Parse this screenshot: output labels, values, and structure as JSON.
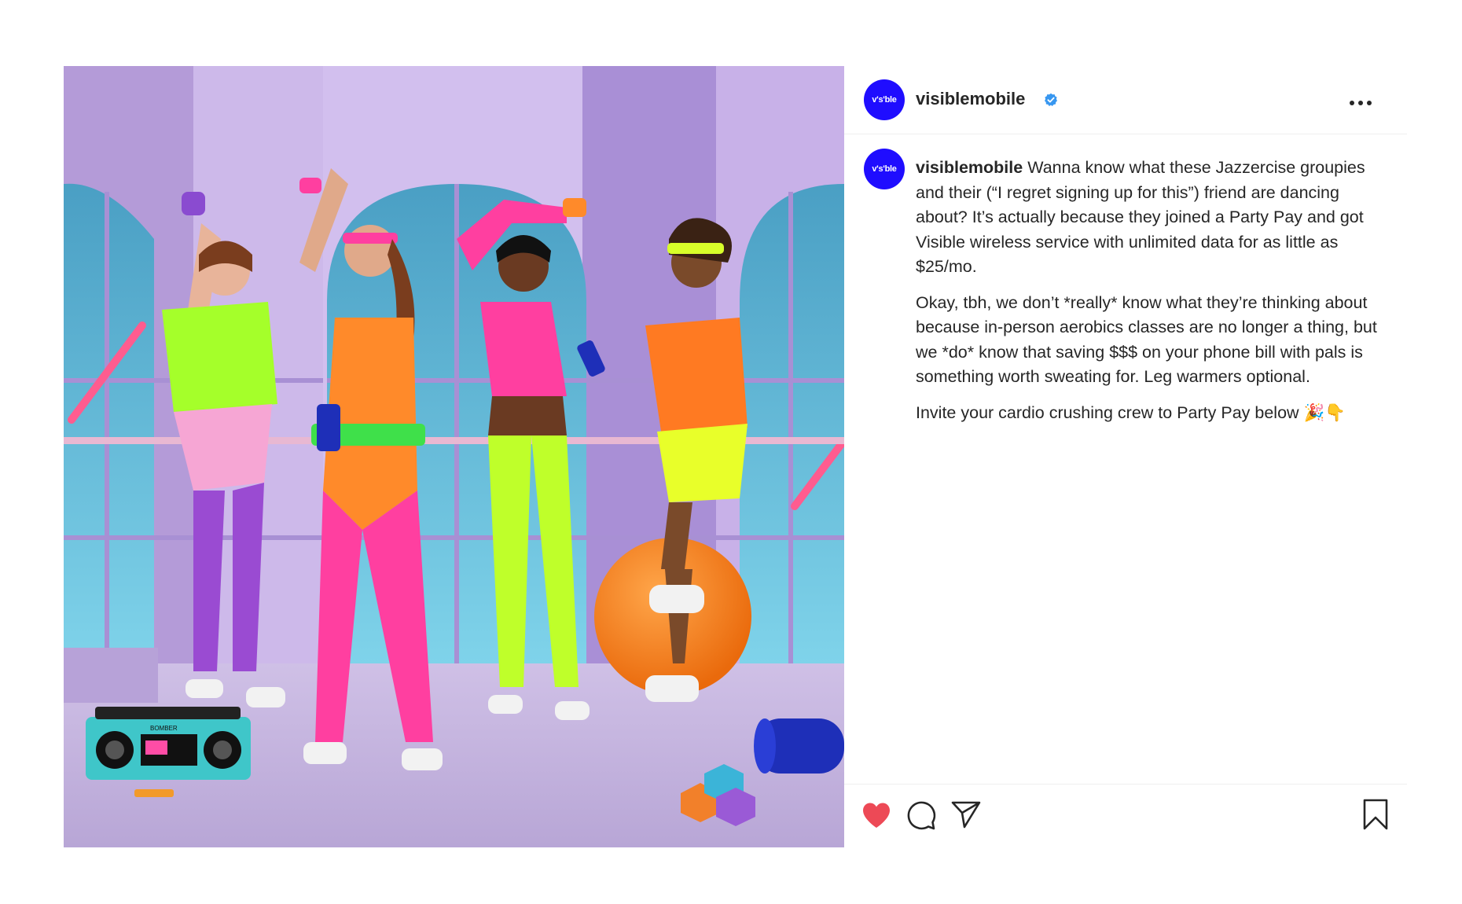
{
  "post": {
    "account": {
      "username": "visiblemobile",
      "avatar_text": "v's'ble",
      "avatar_color": "#1f0dff",
      "verified": true,
      "verified_badge_color": "#3897f0"
    },
    "header": {
      "more_icon": "more-horizontal-icon"
    },
    "caption": {
      "username": "visiblemobile",
      "paragraph_1": "Wanna know what these Jazzercise groupies and their (“I regret signing up for this”) friend are dancing about? It’s actually because they joined a Party Pay and got Visible wireless service with unlimited data for as little as $25/mo.",
      "paragraph_2": "Okay, tbh, we don’t *really* know what they’re thinking about because in-person aerobics classes are no longer a thing, but we *do* know that saving $$$ on your phone bill with pals is something worth sweating for. Leg warmers optional.",
      "paragraph_3": "Invite your cardio crushing crew to Party Pay below 🎉👇"
    },
    "actions": {
      "like_icon": "heart-icon",
      "liked": true,
      "like_color": "#ed4956",
      "comment_icon": "comment-icon",
      "share_icon": "paper-plane-icon",
      "save_icon": "bookmark-icon"
    },
    "photo": {
      "boombox_brand": "BOMBER"
    }
  }
}
